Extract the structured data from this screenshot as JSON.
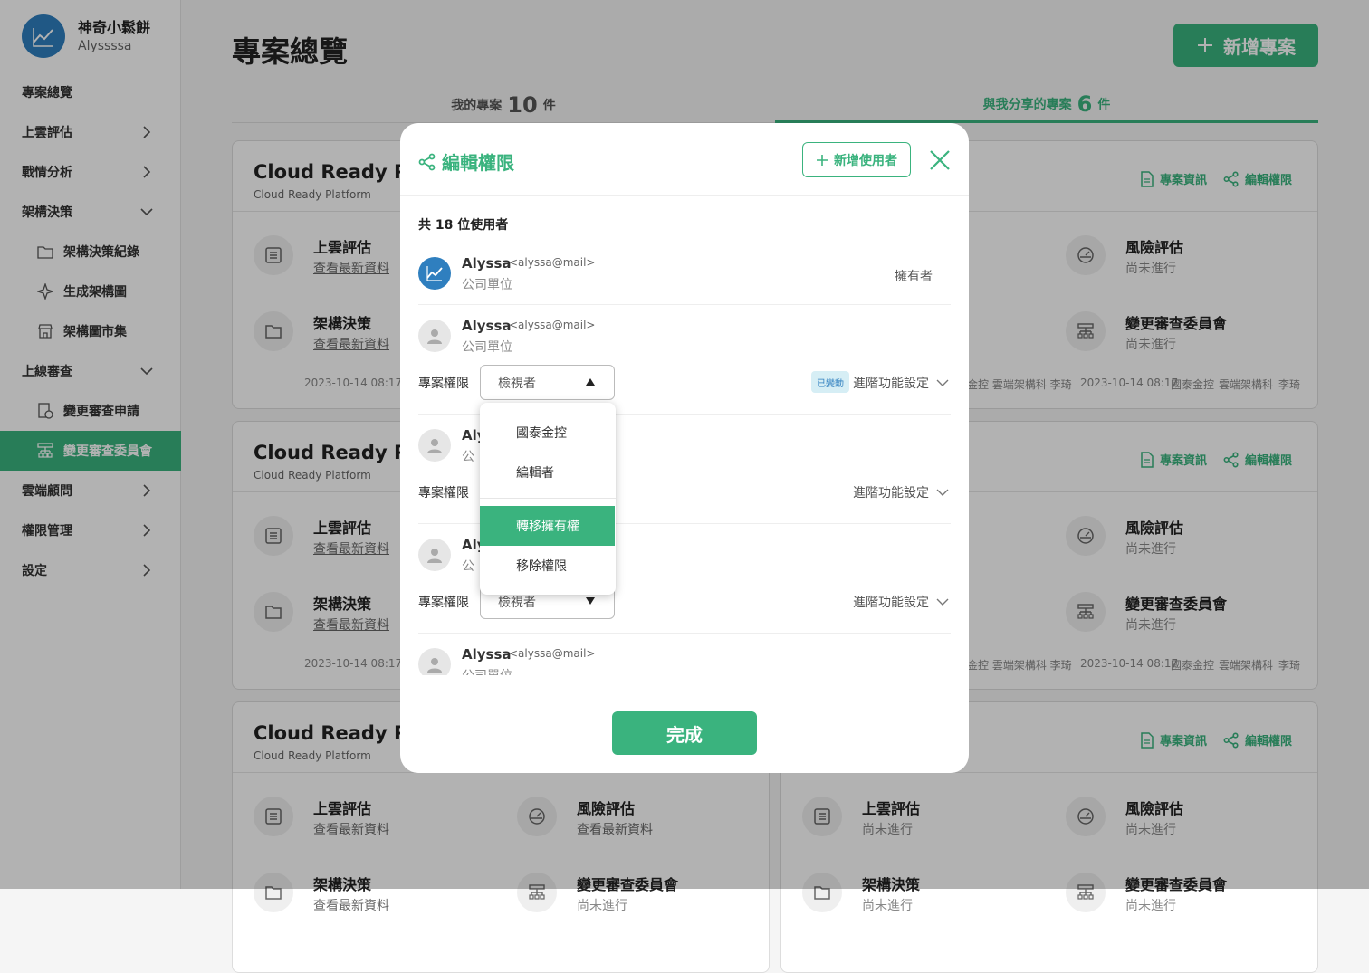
{
  "profile": {
    "name": "神奇小鬆餅",
    "username": "Alyssssa"
  },
  "sidebar": {
    "items": [
      {
        "label": "專案總覽"
      },
      {
        "label": "上雲評估"
      },
      {
        "label": "戰情分析"
      },
      {
        "label": "架構決策"
      },
      {
        "label": "架構決策紀錄"
      },
      {
        "label": "生成架構圖"
      },
      {
        "label": "架構圖市集"
      },
      {
        "label": "上線審查"
      },
      {
        "label": "變更審查申請"
      },
      {
        "label": "變更審查委員會"
      },
      {
        "label": "雲端顧問"
      },
      {
        "label": "權限管理"
      },
      {
        "label": "設定"
      }
    ]
  },
  "header": {
    "title": "專案總覽",
    "new_project": "新增專案"
  },
  "tabs": [
    {
      "label": "我的專案",
      "count": "10",
      "unit": "件"
    },
    {
      "label": "與我分享的專案",
      "count": "6",
      "unit": "件"
    }
  ],
  "card": {
    "title": "Cloud Ready Platform",
    "subtitle": "Cloud Ready Platform",
    "project_info": "專案資訊",
    "edit_permission": "編輯權限"
  },
  "modules": {
    "cloud_eval": "上雲評估",
    "risk_eval": "風險評估",
    "arch_decision": "架構決策",
    "change_board": "變更審查委員會",
    "view_latest": "查看最新資料",
    "not_started": "尚未進行"
  },
  "meta": {
    "timestamp": "2023-10-14 08:17",
    "org": "國泰金控",
    "dept": "雲端架構科",
    "person": "李琦",
    "tail": "金控 雲端架構科 李琦"
  },
  "modal": {
    "title": "編輯權限",
    "add_user": "新增使用者",
    "count_label": "共 18 位使用者",
    "users": [
      {
        "name": "Alyssa",
        "email": "<alyssa@mail>",
        "org": "公司單位",
        "role": "擁有者"
      },
      {
        "name": "Alyssa",
        "email": "<alyssa@mail>",
        "org": "公司單位"
      },
      {
        "name": "Aly",
        "org": "公"
      },
      {
        "name": "Aly",
        "org": "公"
      },
      {
        "name": "Alyssa",
        "email": "<alyssa@mail>",
        "org": "公司單位"
      }
    ],
    "perm_label": "專案權限",
    "viewer": "檢視者",
    "changed_badge": "已變動",
    "advanced": "進階功能設定",
    "done": "完成"
  },
  "dropdown": {
    "options": [
      "國泰金控",
      "編輯者",
      "轉移擁有權",
      "移除權限"
    ]
  },
  "colors": {
    "accent": "#3ab37e",
    "avatar_blue": "#2f7fbf"
  }
}
